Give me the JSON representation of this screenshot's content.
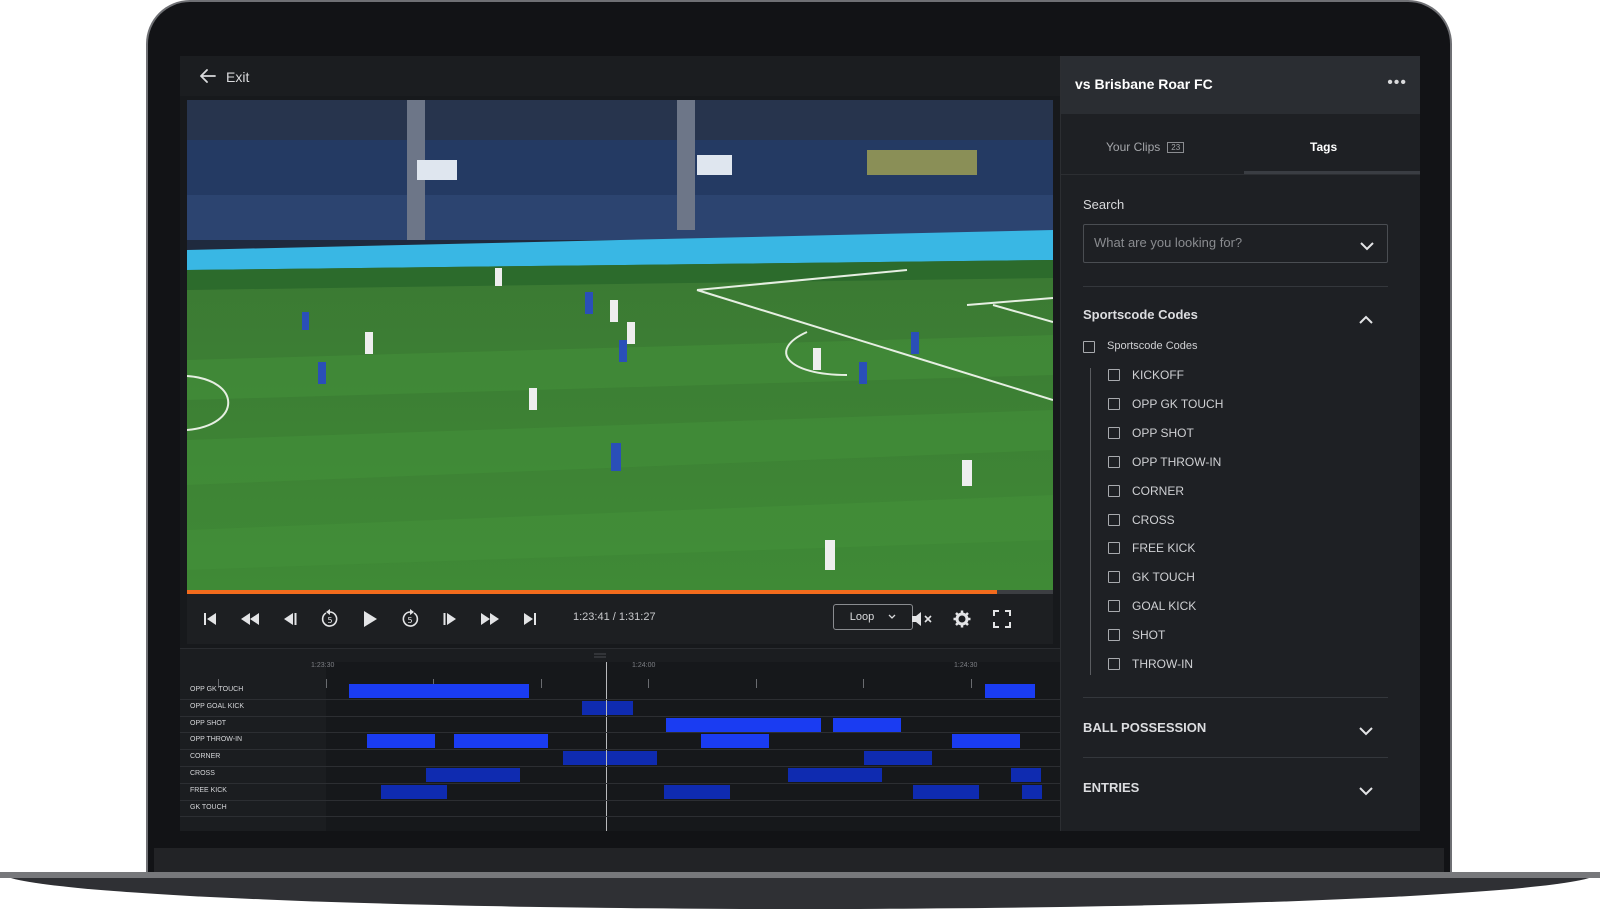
{
  "topbar": {
    "exit_label": "Exit"
  },
  "player": {
    "time_display": "1:23:41 / 1:31:27",
    "progress_fraction": 0.935,
    "loop_label": "Loop"
  },
  "timeline": {
    "time_ticks": [
      "1:23:30",
      "1:24:00",
      "1:24:30"
    ],
    "tracks": [
      {
        "label": "OPP GK TOUCH"
      },
      {
        "label": "OPP GOAL KICK"
      },
      {
        "label": "OPP SHOT"
      },
      {
        "label": "OPP THROW-IN"
      },
      {
        "label": "CORNER"
      },
      {
        "label": "CROSS"
      },
      {
        "label": "FREE KICK"
      },
      {
        "label": "GK TOUCH"
      }
    ]
  },
  "panel": {
    "match_title": "vs Brisbane Roar FC",
    "tabs": {
      "your_clips": "Your Clips",
      "clips_count": "23",
      "tags": "Tags"
    },
    "search": {
      "label": "Search",
      "placeholder": "What are you looking for?"
    },
    "sportscode": {
      "title": "Sportscode Codes",
      "parent_label": "Sportscode Codes",
      "items": [
        "KICKOFF",
        "OPP GK TOUCH",
        "OPP SHOT",
        "OPP THROW-IN",
        "CORNER",
        "CROSS",
        "FREE KICK",
        "GK TOUCH",
        "GOAL KICK",
        "SHOT",
        "THROW-IN"
      ]
    },
    "ball_possession": {
      "title": "BALL POSSESSION"
    },
    "entries": {
      "title": "ENTRIES"
    }
  },
  "colors": {
    "accent_progress": "#f26b1d",
    "clip_blue": "#1a3cf2",
    "clip_dark_blue": "#0f2bb0"
  }
}
